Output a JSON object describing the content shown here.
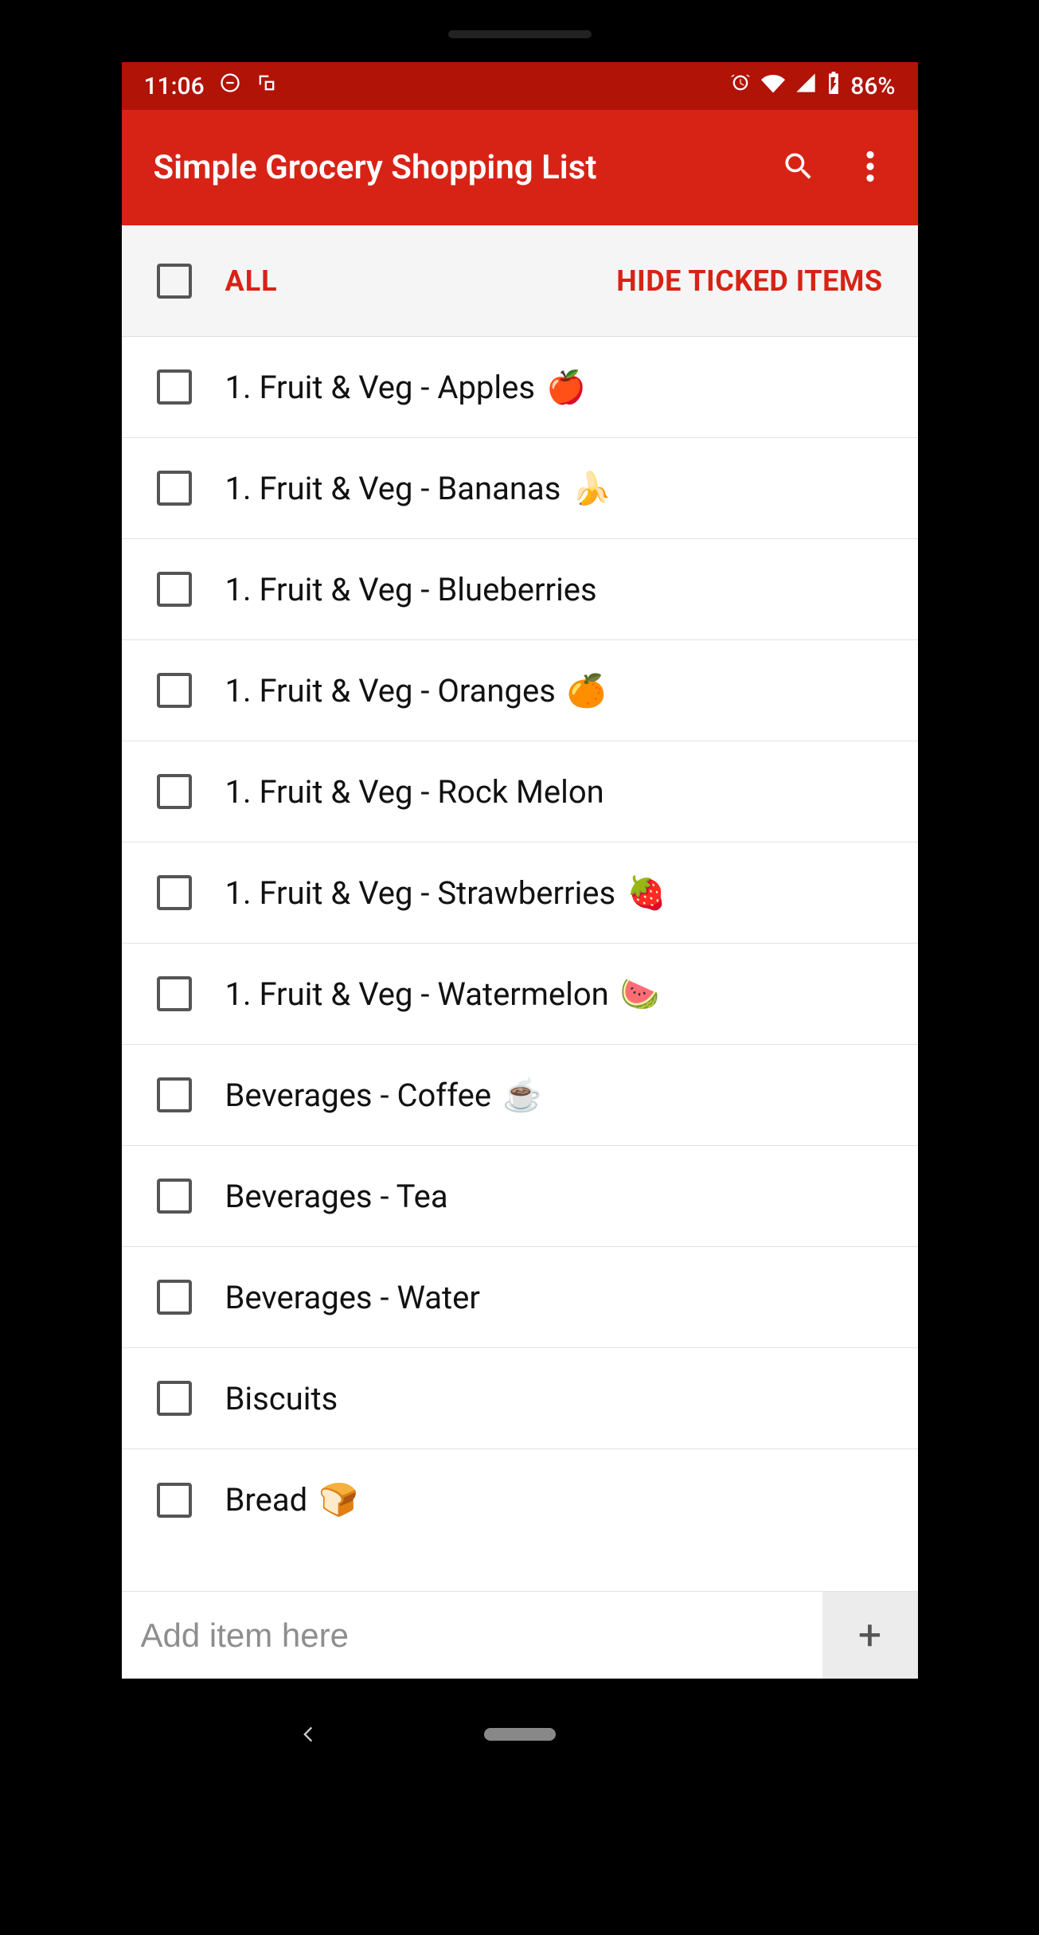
{
  "status": {
    "time": "11:06",
    "battery": "86%"
  },
  "app": {
    "title": "Simple Grocery Shopping List"
  },
  "filter": {
    "all_label": "ALL",
    "hide_label": "HIDE TICKED ITEMS"
  },
  "items": [
    {
      "label": "1. Fruit & Veg - Apples",
      "emoji": "🍎"
    },
    {
      "label": "1. Fruit & Veg - Bananas",
      "emoji": "🍌"
    },
    {
      "label": "1. Fruit & Veg - Blueberries",
      "emoji": ""
    },
    {
      "label": "1. Fruit & Veg - Oranges",
      "emoji": "🍊"
    },
    {
      "label": "1. Fruit & Veg - Rock Melon",
      "emoji": ""
    },
    {
      "label": "1. Fruit & Veg - Strawberries",
      "emoji": "🍓"
    },
    {
      "label": "1. Fruit & Veg - Watermelon",
      "emoji": "🍉"
    },
    {
      "label": "Beverages - Coffee",
      "emoji": "☕"
    },
    {
      "label": "Beverages - Tea",
      "emoji": ""
    },
    {
      "label": "Beverages - Water",
      "emoji": ""
    },
    {
      "label": "Biscuits",
      "emoji": ""
    },
    {
      "label": "Bread",
      "emoji": "🍞"
    }
  ],
  "add": {
    "placeholder": "Add item here",
    "plus": "+"
  }
}
